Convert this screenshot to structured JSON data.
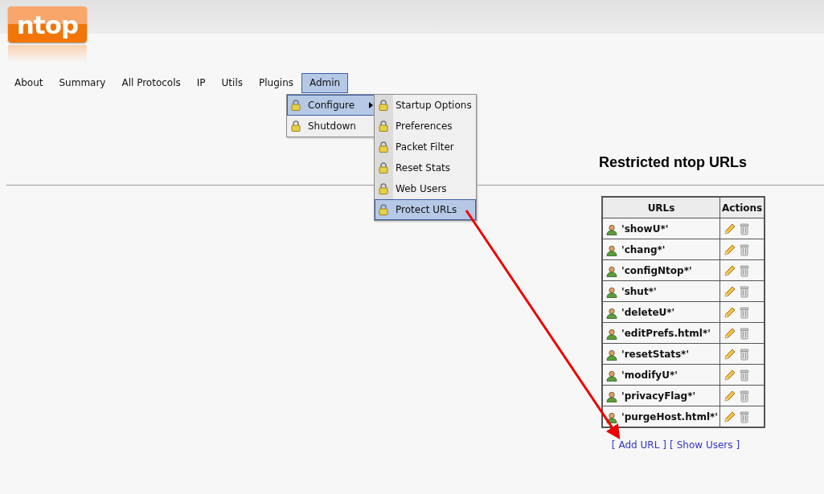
{
  "logo": {
    "text": "ntop"
  },
  "nav": [
    {
      "label": "About",
      "selected": false
    },
    {
      "label": "Summary",
      "selected": false
    },
    {
      "label": "All Protocols",
      "selected": false
    },
    {
      "label": "IP",
      "selected": false
    },
    {
      "label": "Utils",
      "selected": false
    },
    {
      "label": "Plugins",
      "selected": false
    },
    {
      "label": "Admin",
      "selected": true
    }
  ],
  "menu": [
    {
      "label": "Configure",
      "selected": true,
      "submenu": true
    },
    {
      "label": "Shutdown",
      "selected": false,
      "submenu": false
    }
  ],
  "submenu": [
    {
      "label": "Startup Options",
      "selected": false
    },
    {
      "label": "Preferences",
      "selected": false
    },
    {
      "label": "Packet Filter",
      "selected": false
    },
    {
      "label": "Reset Stats",
      "selected": false
    },
    {
      "label": "Web Users",
      "selected": false
    },
    {
      "label": "Protect URLs",
      "selected": true
    }
  ],
  "title": "Restricted ntop URLs",
  "table": {
    "columns": [
      "URLs",
      "Actions"
    ],
    "rows": [
      {
        "url": "'showU*'"
      },
      {
        "url": "'chang*'"
      },
      {
        "url": "'configNtop*'"
      },
      {
        "url": "'shut*'"
      },
      {
        "url": "'deleteU*'"
      },
      {
        "url": "'editPrefs.html*'"
      },
      {
        "url": "'resetStats*'"
      },
      {
        "url": "'modifyU*'"
      },
      {
        "url": "'privacyFlag*'"
      },
      {
        "url": "'purgeHost.html*'"
      }
    ]
  },
  "links": [
    {
      "open": "[",
      "label": "Add URL",
      "close": "]"
    },
    {
      "open": "[",
      "label": "Show Users",
      "close": "]"
    }
  ]
}
